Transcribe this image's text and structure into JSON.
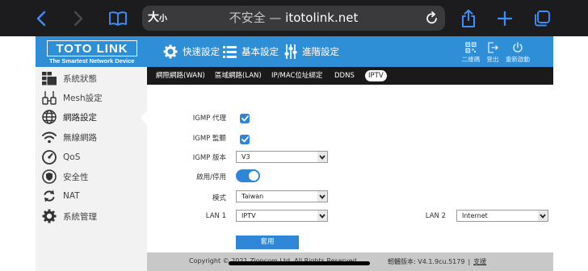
{
  "browser": {
    "text_size_big": "大",
    "text_size_small": "小",
    "insecure_label": "不安全 —",
    "domain": "itotolink.net"
  },
  "router": {
    "logo": "TOTO LINK",
    "tagline": "The Smartest Network Device",
    "nav": [
      "快速設定",
      "基本設定",
      "進階設定"
    ],
    "util": [
      "二維碼",
      "登出",
      "重新啟動"
    ]
  },
  "sidebar": {
    "items": [
      {
        "label": "系統狀態",
        "icon": "dashboard-icon"
      },
      {
        "label": "Mesh設定",
        "icon": "mesh-icon"
      },
      {
        "label": "網路設定",
        "icon": "globe-icon",
        "active": true
      },
      {
        "label": "無線網路",
        "icon": "wifi-icon"
      },
      {
        "label": "QoS",
        "icon": "gauge-icon"
      },
      {
        "label": "安全性",
        "icon": "shield-icon"
      },
      {
        "label": "NAT",
        "icon": "refresh-icon"
      },
      {
        "label": "系統管理",
        "icon": "gear-icon"
      }
    ]
  },
  "tabs": [
    {
      "label": "網際網路(WAN)"
    },
    {
      "label": "區域網路(LAN)"
    },
    {
      "label": "IP/MAC位址綁定"
    },
    {
      "label": "DDNS"
    },
    {
      "label": "IPTV",
      "active": true
    }
  ],
  "form": {
    "igmp_proxy_label": "IGMP 代理",
    "igmp_proxy_checked": true,
    "igmp_snoop_label": "IGMP 監聽",
    "igmp_snoop_checked": true,
    "igmp_version_label": "IGMP 版本",
    "igmp_version_value": "V3",
    "enable_label": "啟用/停用",
    "enable_on": true,
    "mode_label": "模式",
    "mode_value": "Taiwan",
    "lan1_label": "LAN 1",
    "lan1_value": "IPTV",
    "lan2_label": "LAN 2",
    "lan2_value": "Internet",
    "apply_label": "套用"
  },
  "footer": {
    "copyright": "Copyright © 2021 Zioncom Ltd. All Rights Reserved",
    "version": "軔體版本: V4.1.9cu.5179",
    "separator": "|",
    "support": "支援"
  },
  "colors": {
    "header_blue": "#2e8fd6",
    "accent_blue": "#2f86d6",
    "sidebar_bg": "#f2f2f2",
    "tab_bar_bg": "#1a1a1a"
  }
}
